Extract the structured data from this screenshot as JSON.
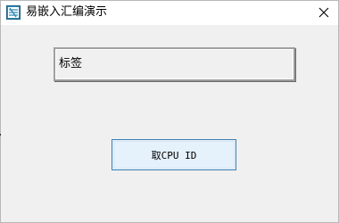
{
  "window": {
    "title": "易嵌入汇编演示",
    "icon": "app-icon",
    "close_icon": "close-icon"
  },
  "main": {
    "label_text": "标签",
    "cpu_button_label": "取CPU ID"
  },
  "colors": {
    "titlebar": "#ffffff",
    "client_bg": "#f0f0f0",
    "button_bg": "#e5f1fb",
    "button_border": "#3c7fb1"
  }
}
